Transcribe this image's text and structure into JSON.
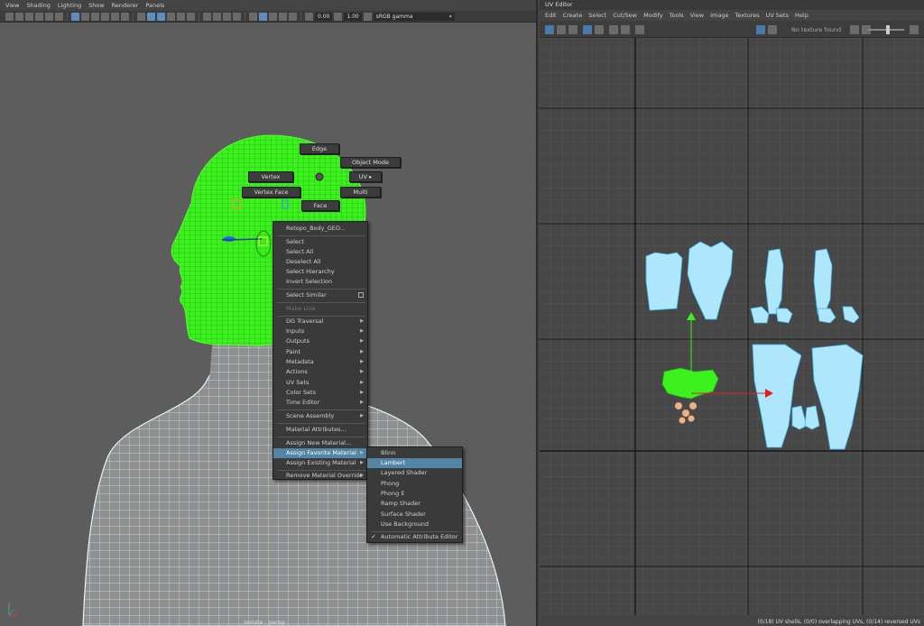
{
  "viewport": {
    "menu": [
      "View",
      "Shading",
      "Lighting",
      "Show",
      "Renderer",
      "Panels"
    ],
    "toolbar": {
      "value1": "0.00",
      "value2": "1.00",
      "colorspace": "sRGB gamma"
    },
    "camera_label": "isolate : persp",
    "marking_menu": {
      "edge": "Edge",
      "object_mode": "Object Mode",
      "vertex": "Vertex",
      "uv": "UV",
      "vertex_face": "Vertex Face",
      "multi": "Multi",
      "face": "Face"
    },
    "context_menu": {
      "title": "Retopo_Body_GEO...",
      "items": {
        "select": "Select",
        "select_all": "Select All",
        "deselect_all": "Deselect All",
        "select_hierarchy": "Select Hierarchy",
        "invert_selection": "Invert Selection",
        "select_similar": "Select Similar",
        "make_live": "Make Live",
        "dg_traversal": "DG Traversal",
        "inputs": "Inputs",
        "outputs": "Outputs",
        "paint": "Paint",
        "metadata": "Metadata",
        "actions": "Actions",
        "uv_sets": "UV Sets",
        "color_sets": "Color Sets",
        "time_editor": "Time Editor",
        "scene_assembly": "Scene Assembly",
        "material_attributes": "Material Attributes...",
        "assign_new_material": "Assign New Material...",
        "assign_favorite_material": "Assign Favorite Material",
        "assign_existing_material": "Assign Existing Material",
        "remove_material_override": "Remove Material Override"
      }
    },
    "submenu": {
      "blinn": "Blinn",
      "lambert": "Lambert",
      "layered_shader": "Layered Shader",
      "phong": "Phong",
      "phong_e": "Phong E",
      "ramp_shader": "Ramp Shader",
      "surface_shader": "Surface Shader",
      "use_background": "Use Background",
      "automatic_attribute_editor": "Automatic Attribute Editor",
      "check": "✓"
    }
  },
  "uv_editor": {
    "title": "UV Editor",
    "menu": [
      "Edit",
      "Create",
      "Select",
      "Cut/Sew",
      "Modify",
      "Tools",
      "View",
      "Image",
      "Textures",
      "UV Sets",
      "Help"
    ],
    "no_texture": "No texture found",
    "status": "(0/18) UV shells, (0/0) overlapping UVs, (0/14) reversed UVs"
  },
  "colors": {
    "selected_mesh": "#39ff14",
    "wire": "#7fdcff",
    "highlight": "#5285a6"
  }
}
